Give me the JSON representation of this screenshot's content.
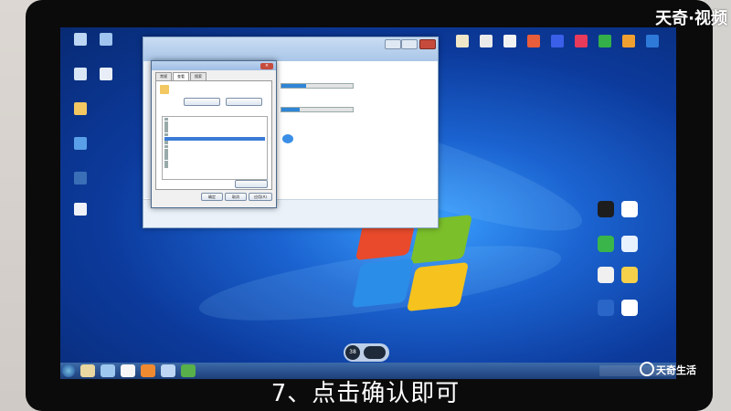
{
  "caption": "7、点击确认即可",
  "watermark_top": "天奇·视频",
  "watermark_bottom": "天奇生活",
  "dialog": {
    "tabs": [
      "常规",
      "查看",
      "搜索"
    ],
    "ok_label": "确定",
    "cancel_label": "取消",
    "apply_label": "应用(A)"
  },
  "gadget": {
    "value": "38"
  },
  "colors": {
    "desktop_blue": "#1b63d0",
    "taskbar": "#1d3f7a",
    "selection": "#3a7bd5"
  }
}
